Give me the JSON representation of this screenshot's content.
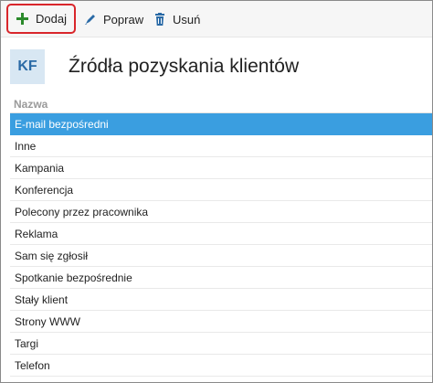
{
  "toolbar": {
    "add_label": "Dodaj",
    "edit_label": "Popraw",
    "delete_label": "Usuń"
  },
  "header": {
    "badge": "KF",
    "title": "Źródła pozyskania klientów"
  },
  "table": {
    "column_header": "Nazwa",
    "rows": [
      "E-mail bezpośredni",
      "Inne",
      "Kampania",
      "Konferencja",
      "Polecony przez pracownika",
      "Reklama",
      "Sam się zgłosił",
      "Spotkanie bezpośrednie",
      "Stały klient",
      "Strony WWW",
      "Targi",
      "Telefon"
    ],
    "selected_index": 0
  },
  "colors": {
    "selection": "#3a9ee0",
    "add_highlight": "#d9262b",
    "plus_icon": "#2b8a2b",
    "pencil_icon": "#2a6aa6",
    "trash_icon": "#2a6aa6"
  }
}
